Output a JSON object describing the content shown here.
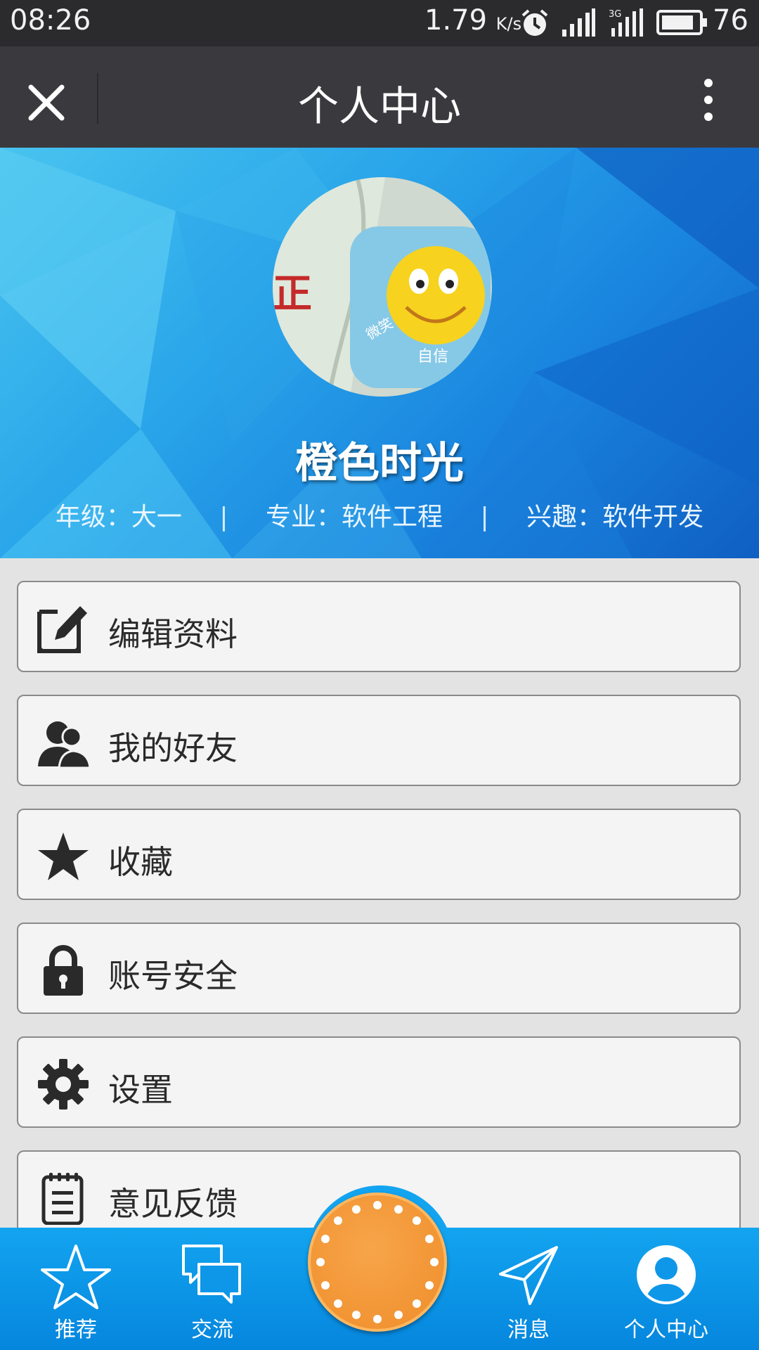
{
  "status_bar": {
    "time": "08:26",
    "speed_value": "1.79",
    "speed_unit": "K/s",
    "network_label": "3G",
    "battery": "76"
  },
  "title_bar": {
    "title": "个人中心"
  },
  "profile": {
    "nickname": "橙色时光",
    "grade_label": "年级：",
    "grade": "大一",
    "major_label": "专业：",
    "major": "软件工程",
    "interest_label": "兴趣：",
    "interest": "软件开发",
    "separator": "|",
    "avatar_text_1": "正",
    "avatar_text_2": "微笑",
    "avatar_text_3": "自信"
  },
  "menu": [
    {
      "label": "编辑资料",
      "icon": "edit-icon"
    },
    {
      "label": "我的好友",
      "icon": "friends-icon"
    },
    {
      "label": "收藏",
      "icon": "star-icon"
    },
    {
      "label": "账号安全",
      "icon": "lock-icon"
    },
    {
      "label": "设置",
      "icon": "gear-icon"
    },
    {
      "label": "意见反馈",
      "icon": "clipboard-icon"
    }
  ],
  "bottom_nav": [
    {
      "label": "推荐",
      "icon": "star-outline-icon"
    },
    {
      "label": "交流",
      "icon": "chat-icon"
    },
    {
      "label": "",
      "icon": "orange-center-icon"
    },
    {
      "label": "消息",
      "icon": "paper-plane-icon"
    },
    {
      "label": "个人中心",
      "icon": "user-icon"
    }
  ],
  "colors": {
    "status_bar_bg": "#2b2b2d",
    "title_bar_bg": "#3a3a3e",
    "banner_blue": "#1a86df",
    "nav_blue": "#0586dd",
    "center_orange": "#ef8d2a",
    "menu_bg": "#f4f4f4",
    "page_bg": "#e3e3e3"
  }
}
